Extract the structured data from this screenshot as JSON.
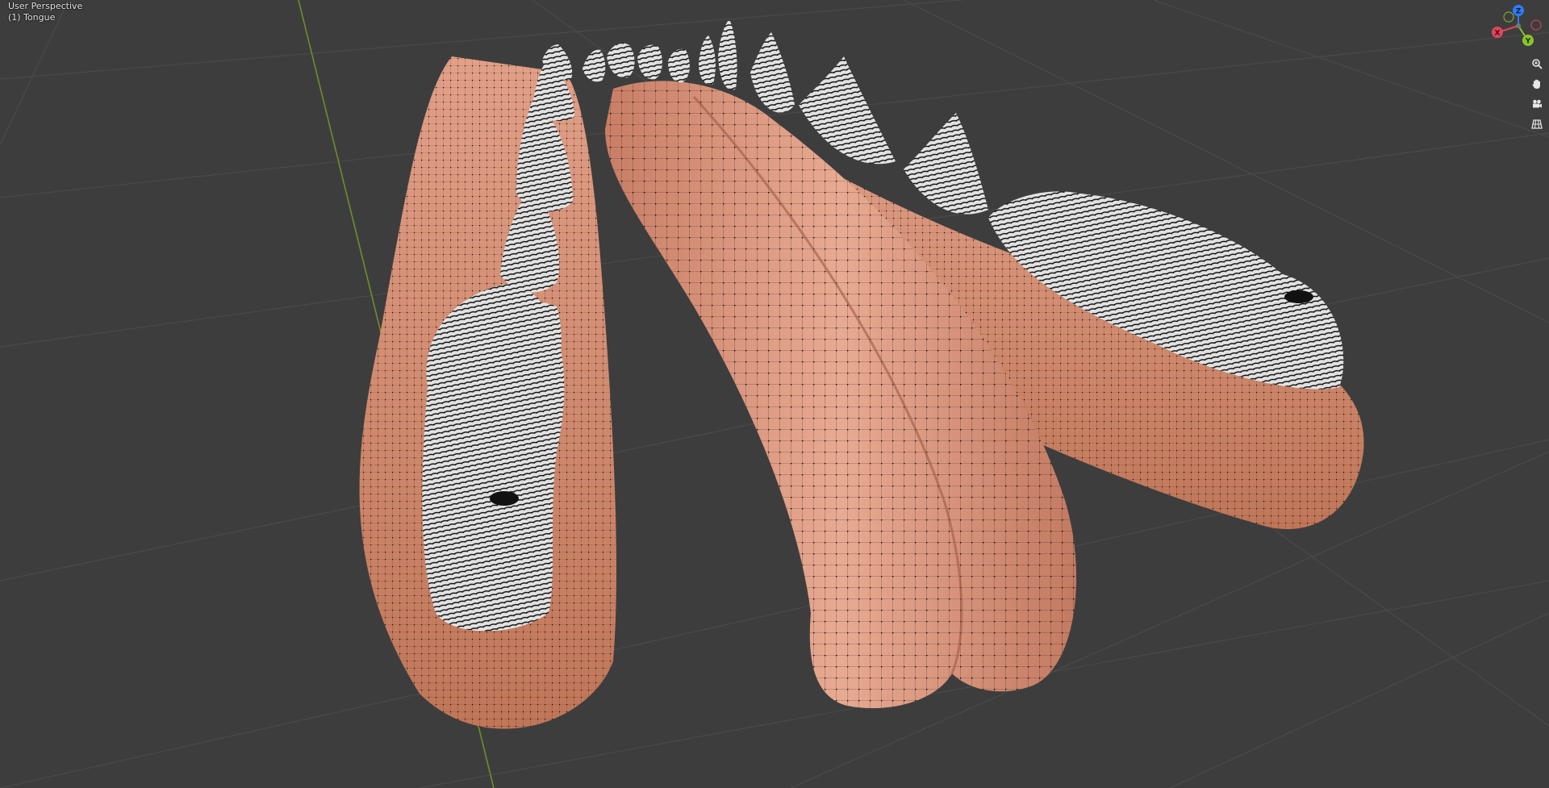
{
  "viewport": {
    "view_label": "User Perspective",
    "object_label": "(1) Tongue",
    "background": "#3d3d3d"
  },
  "gizmo": {
    "axes": [
      {
        "axis": "Z",
        "color": "#2f7bf5"
      },
      {
        "axis": "Y",
        "color": "#8bc42a"
      },
      {
        "axis": "X",
        "color": "#e0475c"
      }
    ]
  },
  "navigation": [
    {
      "name": "zoom-icon"
    },
    {
      "name": "pan-hand-icon"
    },
    {
      "name": "camera-icon"
    },
    {
      "name": "ortho-grid-icon"
    }
  ],
  "mesh": {
    "skin_color": "#d99176",
    "teeth_color": "#dcdcdc",
    "wire_color": "#1a1a1a"
  }
}
